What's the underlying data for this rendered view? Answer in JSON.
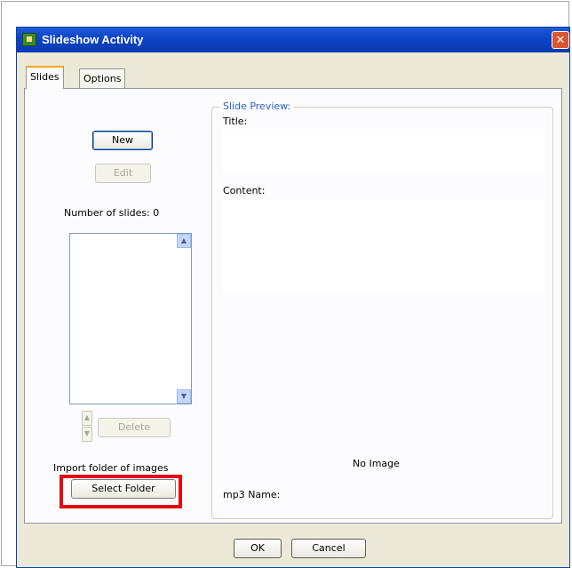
{
  "window": {
    "title": "Slideshow Activity",
    "close_glyph": "✕"
  },
  "tabs": [
    {
      "label": "Slides",
      "active": true
    },
    {
      "label": "Options",
      "active": false
    }
  ],
  "left": {
    "new_label": "New",
    "edit_label": "Edit",
    "count_label": "Number of slides: 0",
    "delete_label": "Delete",
    "import_label": "Import folder of images",
    "select_folder_label": "Select Folder"
  },
  "preview": {
    "legend": "Slide Preview:",
    "title_label": "Title:",
    "content_label": "Content:",
    "no_image": "No Image",
    "mp3_label": "mp3 Name:"
  },
  "footer": {
    "ok_label": "OK",
    "cancel_label": "Cancel"
  },
  "icons": {
    "scroll_up": "▲",
    "scroll_down": "▼",
    "close": "close-icon",
    "app": "slideshow-app-icon"
  },
  "colors": {
    "titlebar": "#0c43c4",
    "highlight": "#e10b12",
    "legend_text": "#2a61c9",
    "active_tab_accent": "#f5a623"
  }
}
